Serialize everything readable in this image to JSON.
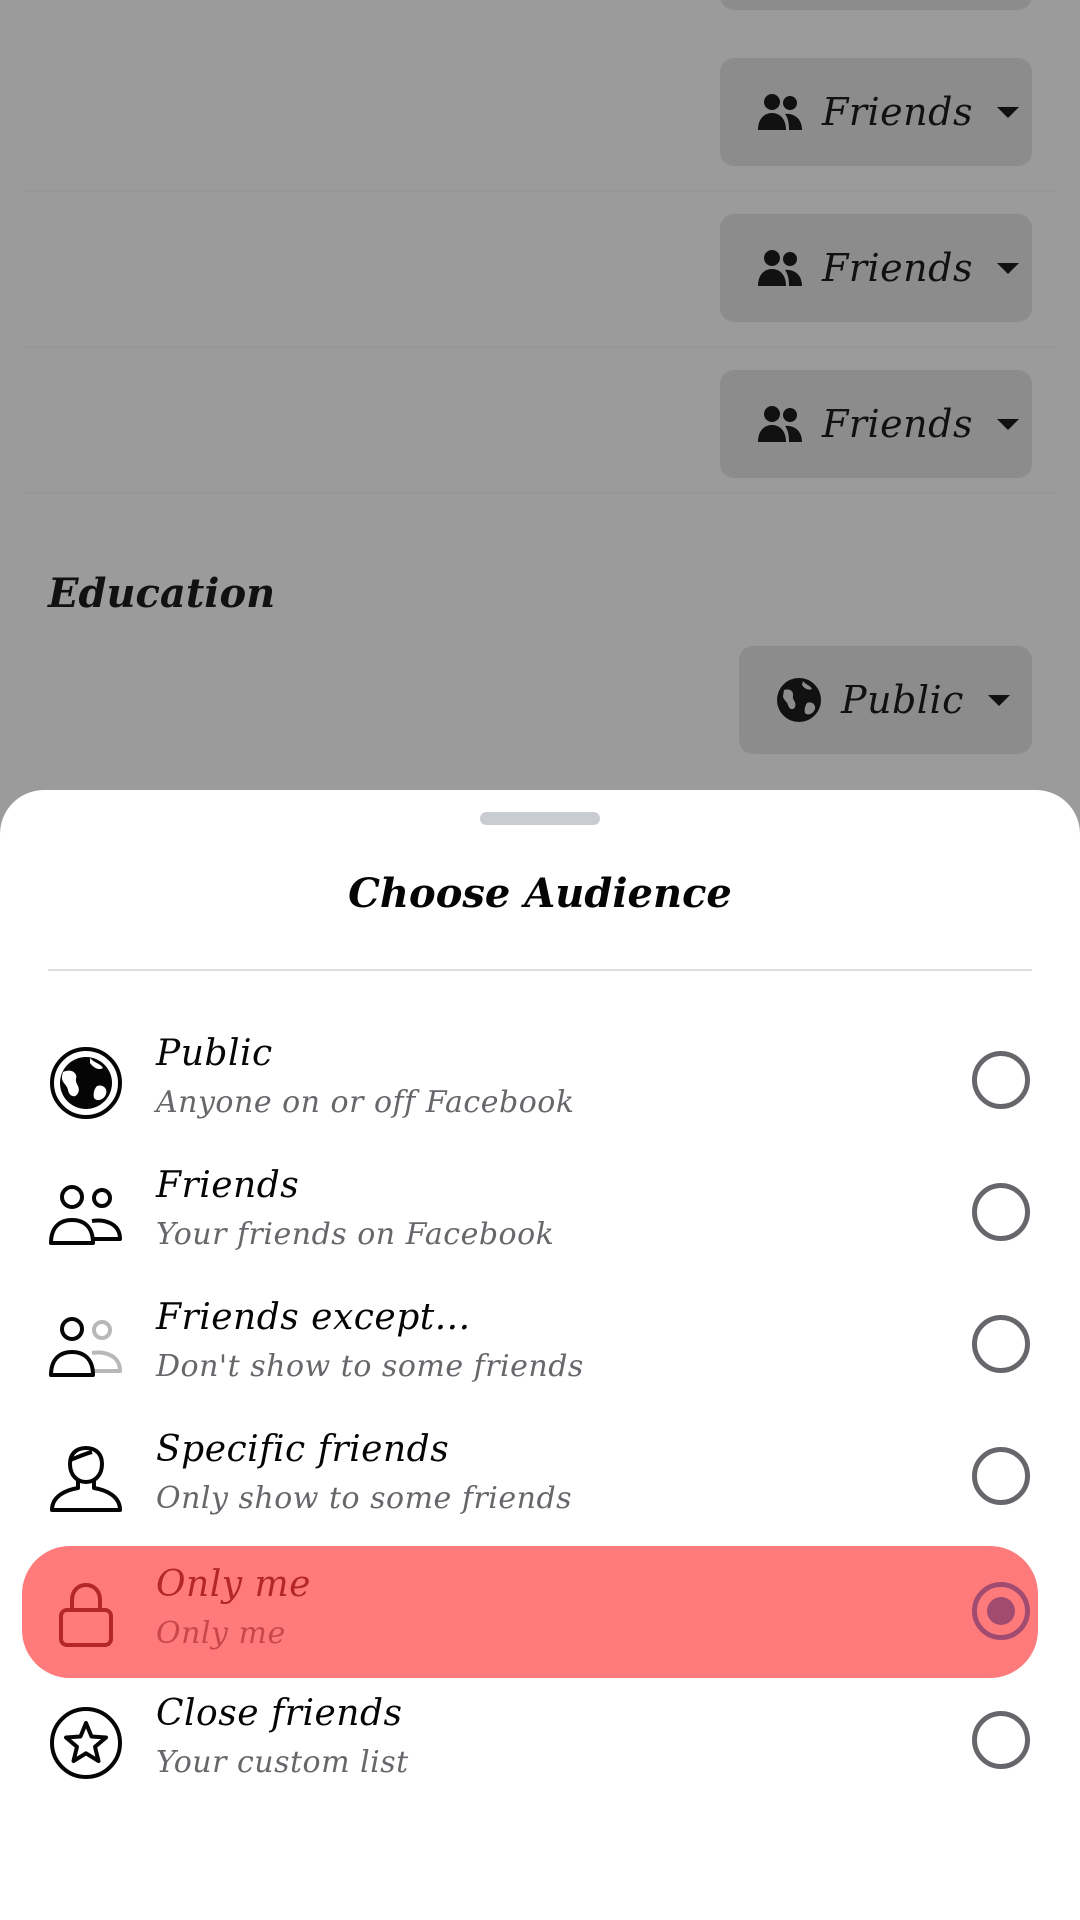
{
  "background": {
    "rows": [
      {
        "label": "Friends",
        "icon": "friends-icon"
      },
      {
        "label": "Friends",
        "icon": "friends-icon"
      },
      {
        "label": "Friends",
        "icon": "friends-icon"
      }
    ],
    "section_title": "Education",
    "education_button": {
      "label": "Public",
      "icon": "globe-icon"
    }
  },
  "sheet": {
    "title": "Choose Audience",
    "options": [
      {
        "title": "Public",
        "subtitle": "Anyone on or off Facebook",
        "icon": "globe-icon",
        "selected": false
      },
      {
        "title": "Friends",
        "subtitle": "Your friends on Facebook",
        "icon": "friends-outline-icon",
        "selected": false
      },
      {
        "title": "Friends except...",
        "subtitle": "Don't show to some friends",
        "icon": "friends-except-icon",
        "selected": false
      },
      {
        "title": "Specific friends",
        "subtitle": "Only show to some friends",
        "icon": "person-icon",
        "selected": false
      },
      {
        "title": "Only me",
        "subtitle": "Only me",
        "icon": "lock-icon",
        "selected": true
      },
      {
        "title": "Close friends",
        "subtitle": "Your custom list",
        "icon": "star-icon",
        "selected": false
      }
    ]
  },
  "colors": {
    "overlay": "#9b9b9b",
    "highlight": "#ff7b7b",
    "selected_radio": "#a24b71",
    "secondary_text": "#65676b"
  }
}
